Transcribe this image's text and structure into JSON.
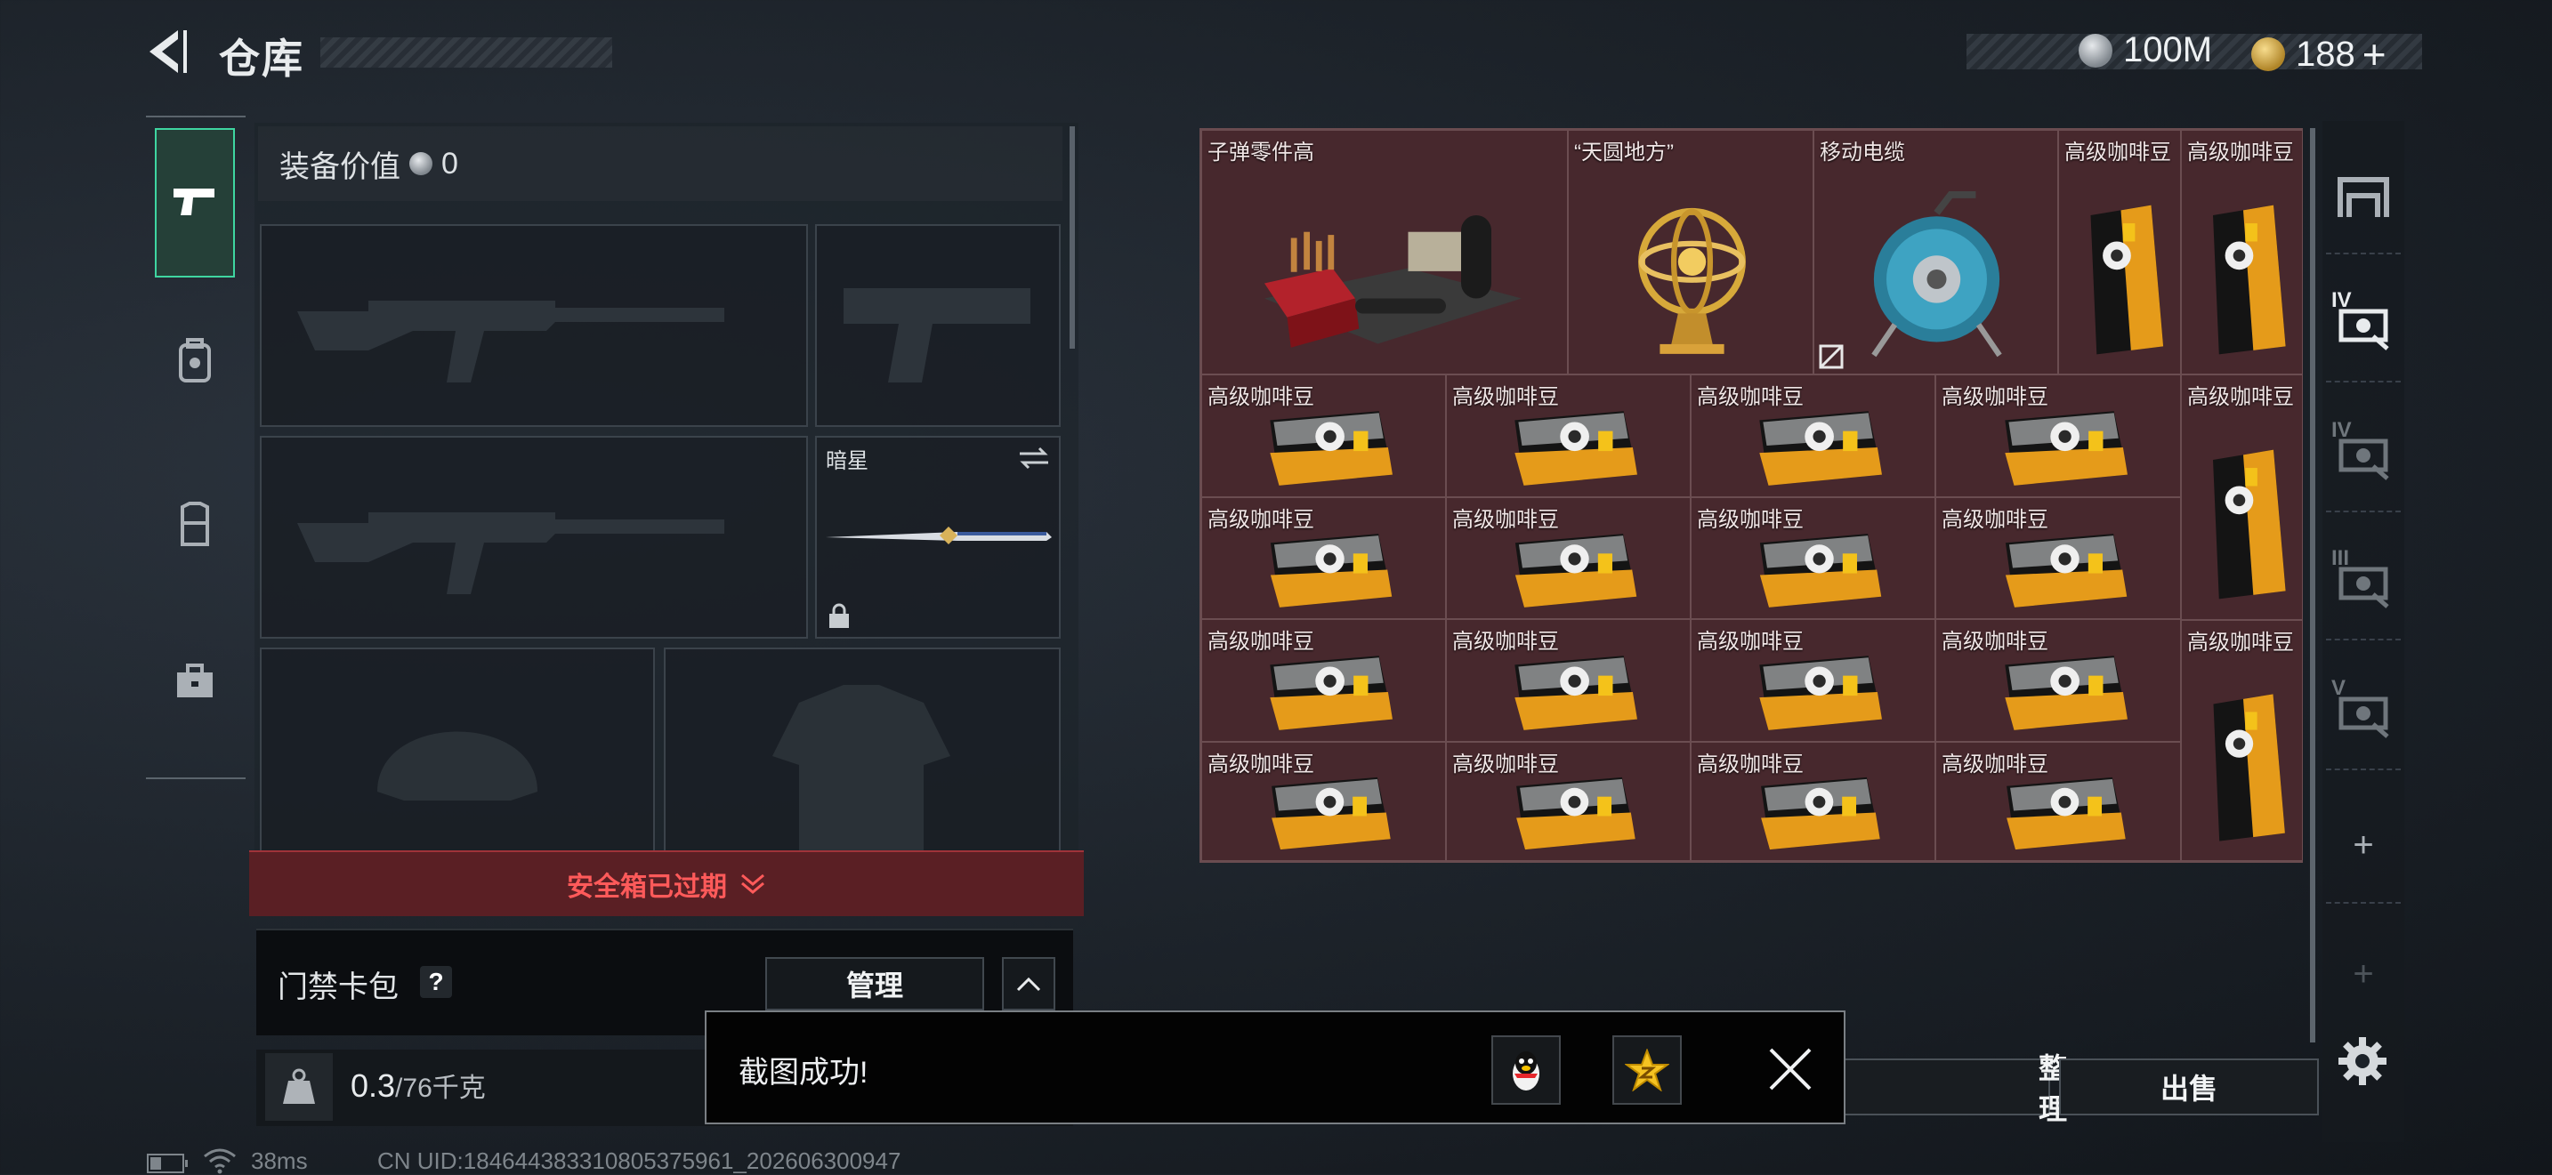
{
  "header": {
    "title": "仓库",
    "currency_silver": "100M",
    "currency_gold": "188",
    "gold_plus": "+"
  },
  "equipment": {
    "value_label": "装备价值",
    "value": "0",
    "melee_name": "暗星",
    "safebox_status": "安全箱已过期"
  },
  "card_pack": {
    "label": "门禁卡包",
    "help": "?",
    "manage_button": "管理"
  },
  "weight": {
    "current": "0.3",
    "capacity": "/76千克"
  },
  "stash": {
    "items": [
      {
        "label": "子弹零件高",
        "kind": "parts"
      },
      {
        "label": "“天圆地方”",
        "kind": "globe"
      },
      {
        "label": "移动电缆",
        "kind": "cable"
      },
      {
        "label": "高级咖啡豆",
        "kind": "coffee-tall"
      },
      {
        "label": "高级咖啡豆",
        "kind": "coffee-tall"
      },
      {
        "label": "高级咖啡豆",
        "kind": "coffee"
      },
      {
        "label": "高级咖啡豆",
        "kind": "coffee"
      },
      {
        "label": "高级咖啡豆",
        "kind": "coffee"
      },
      {
        "label": "高级咖啡豆",
        "kind": "coffee"
      },
      {
        "label": "高级咖啡豆",
        "kind": "coffee-tall"
      },
      {
        "label": "高级咖啡豆",
        "kind": "coffee"
      },
      {
        "label": "高级咖啡豆",
        "kind": "coffee"
      },
      {
        "label": "高级咖啡豆",
        "kind": "coffee"
      },
      {
        "label": "高级咖啡豆",
        "kind": "coffee"
      },
      {
        "label": "高级咖啡豆",
        "kind": "coffee"
      },
      {
        "label": "高级咖啡豆",
        "kind": "coffee"
      },
      {
        "label": "高级咖啡豆",
        "kind": "coffee"
      },
      {
        "label": "高级咖啡豆",
        "kind": "coffee"
      },
      {
        "label": "高级咖啡豆",
        "kind": "coffee-tall"
      },
      {
        "label": "高级咖啡豆",
        "kind": "coffee"
      },
      {
        "label": "高级咖啡豆",
        "kind": "coffee"
      },
      {
        "label": "高级咖啡豆",
        "kind": "coffee"
      },
      {
        "label": "高级咖啡豆",
        "kind": "coffee"
      }
    ]
  },
  "filters": [
    "IV",
    "IV",
    "III",
    "V"
  ],
  "filter_plus": [
    "+",
    "+"
  ],
  "buttons": {
    "sort": "整理",
    "sell": "出售"
  },
  "toast": {
    "message": "截图成功!"
  },
  "status_bar": {
    "ping": "38ms",
    "uid": "CN UID:18464438331080537596​1_202606300947"
  },
  "colors": {
    "accent": "#3fd6a1",
    "danger": "#ff5a5a",
    "item_bg": "#47282d"
  }
}
